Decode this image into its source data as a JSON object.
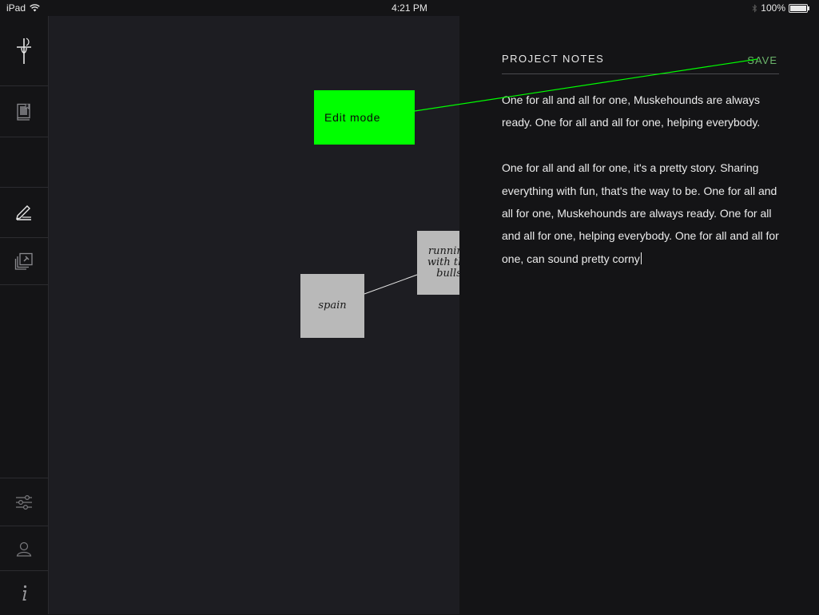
{
  "status_bar": {
    "device": "iPad",
    "time": "4:21 PM",
    "battery": "100%",
    "battery_level": 1.0
  },
  "sidebar": {
    "items": [
      {
        "icon": "pen-cross-logo-icon"
      },
      {
        "icon": "notebook-icon"
      },
      {
        "icon": "blank"
      },
      {
        "icon": "write-pen-icon"
      },
      {
        "icon": "pinned-stack-icon"
      },
      {
        "icon": "sliders-icon"
      },
      {
        "icon": "user-icon"
      },
      {
        "icon": "info-icon"
      }
    ]
  },
  "canvas": {
    "cards": [
      {
        "text": "spain"
      },
      {
        "text": "running with the bulls"
      }
    ]
  },
  "notes_panel": {
    "title": "PROJECT NOTES",
    "save_label": "SAVE",
    "paragraphs": [
      "One for all and all for one, Muskehounds are always ready. One for all and all for one, helping everybody.",
      "One for all and all for one, it's a pretty story. Sharing everything with fun, that's the way to be. One for all and all for one, Muskehounds are always ready. One for all and all for one, helping everybody. One for all and all for one, can sound pretty corny"
    ]
  },
  "annotation": {
    "label": "Edit mode",
    "color": "#00ff00"
  }
}
